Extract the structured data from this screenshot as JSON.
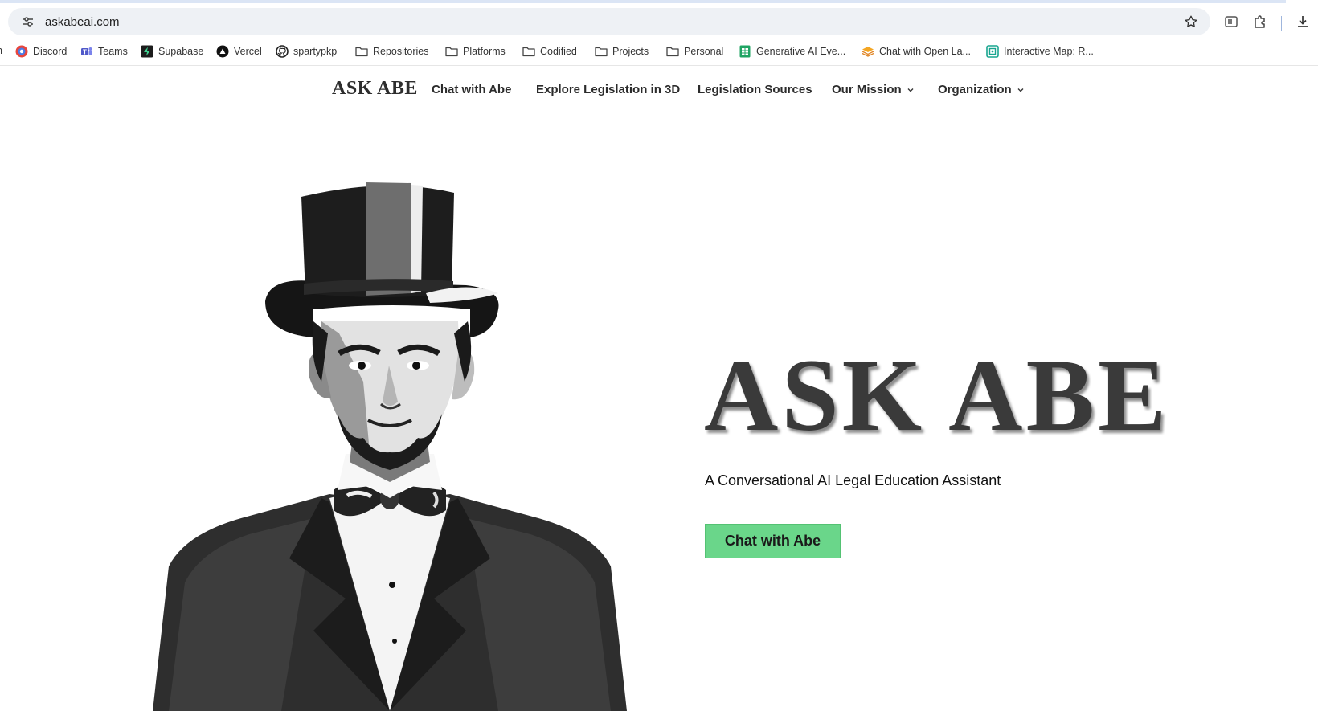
{
  "browser": {
    "url": "askabeai.com",
    "icons": [
      "tune-icon",
      "star-icon",
      "extension-puzzle-icon",
      "download-icon"
    ]
  },
  "bookmarks": [
    {
      "label": "Discord",
      "icon": "discord-icon"
    },
    {
      "label": "Teams",
      "icon": "teams-icon"
    },
    {
      "label": "Supabase",
      "icon": "supabase-icon"
    },
    {
      "label": "Vercel",
      "icon": "vercel-icon"
    },
    {
      "label": "spartypkp",
      "icon": "github-icon"
    },
    {
      "label": "Repositories",
      "icon": "folder-icon"
    },
    {
      "label": "Platforms",
      "icon": "folder-icon"
    },
    {
      "label": "Codified",
      "icon": "folder-icon"
    },
    {
      "label": "Projects",
      "icon": "folder-icon"
    },
    {
      "label": "Personal",
      "icon": "folder-icon"
    },
    {
      "label": "Generative AI Eve...",
      "icon": "sheets-icon"
    },
    {
      "label": "Chat with Open La...",
      "icon": "stack-icon"
    },
    {
      "label": "Interactive Map: R...",
      "icon": "map-icon"
    }
  ],
  "nav": {
    "brand": "ASK ABE",
    "links": [
      {
        "label": "Chat with Abe"
      },
      {
        "label": "Explore Legislation in 3D"
      },
      {
        "label": "Legislation Sources"
      },
      {
        "label": "Our Mission",
        "dropdown": true
      },
      {
        "label": "Organization",
        "dropdown": true
      }
    ]
  },
  "hero": {
    "title": "ASK ABE",
    "subtitle": "A Conversational AI Legal Education Assistant",
    "cta_label": "Chat with Abe",
    "cta_color": "#6ad68a"
  }
}
